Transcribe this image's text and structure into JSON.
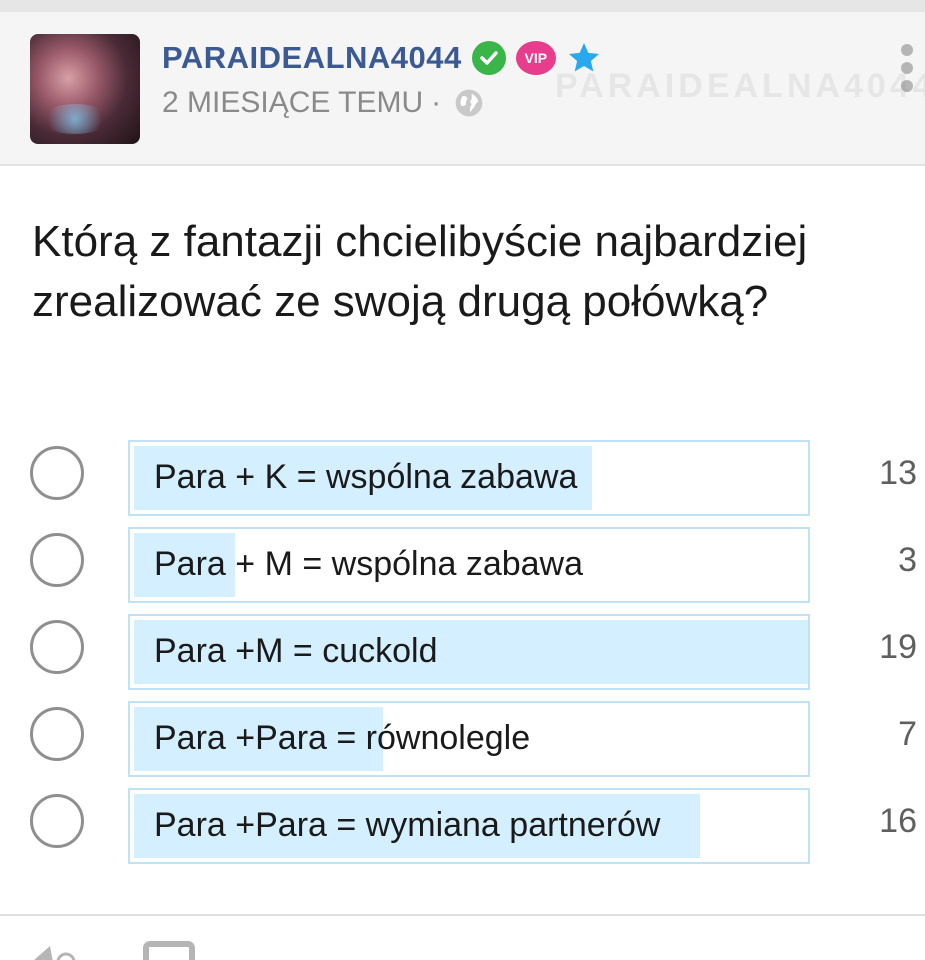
{
  "post": {
    "username": "PARAIDEALNA4044",
    "badges": {
      "verified_icon": "check-circle-icon",
      "vip_label": "VIP",
      "star_icon": "star-icon"
    },
    "time": "2 MIESIĄCE TEMU",
    "separator": "·",
    "visibility_icon": "globe-icon",
    "more_icon": "vertical-dots-icon"
  },
  "poll": {
    "question": "Którą z fantazji chcielibyście najbardziej zrealizować ze swoją drugą połówką?",
    "options": [
      {
        "label": "Para + K = wspólna zabawa",
        "votes": "13",
        "fraction": 0.68
      },
      {
        "label": "Para + M = wspólna zabawa",
        "votes": "3",
        "fraction": 0.15
      },
      {
        "label": "Para +M = cuckold",
        "votes": "19",
        "fraction": 1.0
      },
      {
        "label": "Para +Para = równolegle",
        "votes": "7",
        "fraction": 0.37
      },
      {
        "label": "Para +Para = wymiana partnerów",
        "votes": "16",
        "fraction": 0.84
      }
    ]
  },
  "colors": {
    "username": "#3b5a93",
    "verified": "#3ab54a",
    "vip": "#e83c8c",
    "star": "#2aa8ee",
    "bar_fill": "#d4efff",
    "bar_border": "#bfe3f4"
  }
}
